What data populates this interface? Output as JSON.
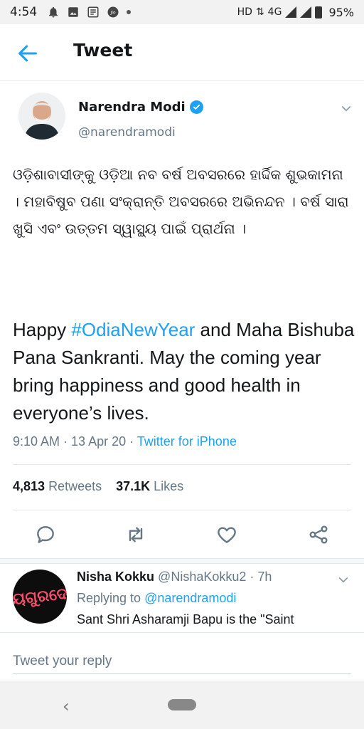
{
  "status_bar": {
    "time": "4:54",
    "network": "HD",
    "signal_type": "4G",
    "battery_pct": "95%"
  },
  "header": {
    "title": "Tweet",
    "back_icon": "arrow-left-icon"
  },
  "tweet": {
    "author_name": "Narendra Modi",
    "author_handle": "@narendramodi",
    "verified": true,
    "text_odia": "ଓଡ଼ିଶାବାସୀଙ୍କୁ ଓଡ଼ିଆ ନବ ବର୍ଷ ଅବସରରେ ହାର୍ଦ୍ଦିକ ଶୁଭକାମନା । ମହାବିଷୁବ ପଣା ସଂକ୍ରାନ୍ତି ଅବସରରେ ଅଭିନନ୍ଦନ । ବର୍ଷ ସାରା ଖୁସି ଏବଂ ଉତ୍ତମ ସ୍ୱାସ୍ଥ୍ୟ ପାଇଁ ପ୍ରାର୍ଥନା ।",
    "text_en_before": "Happy ",
    "hashtag": "#OdiaNewYear",
    "text_en_after": " and Maha Bishuba Pana Sankranti. May the coming year bring happiness and good health in everyone’s lives.",
    "timestamp": "9:10 AM · 13 Apr 20 · ",
    "source": "Twitter for iPhone",
    "retweets_count": "4,813",
    "retweets_label": "Retweets",
    "likes_count": "37.1K",
    "likes_label": "Likes",
    "actions": [
      "reply-icon",
      "retweet-icon",
      "like-icon",
      "share-icon"
    ]
  },
  "reply": {
    "author_name": "Nisha Kokku",
    "author_handle": "@NishaKokku2",
    "age": "· 7h",
    "replying_to_label": "Replying to ",
    "replying_to": "@narendramodi",
    "text": "Sant Shri Asharamji Bapu is the \"Saint",
    "avatar_text": "ଜୟଗୁରଦେବ"
  },
  "composer": {
    "placeholder": "Tweet your reply"
  },
  "colors": {
    "accent": "#1da1f2",
    "text": "#14171a",
    "secondary": "#657786"
  }
}
